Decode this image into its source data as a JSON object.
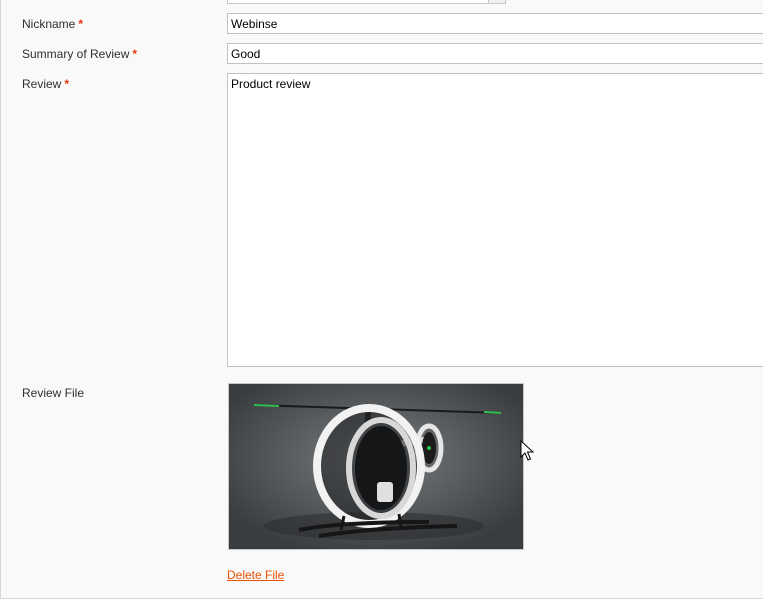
{
  "form": {
    "nickname": {
      "label": "Nickname",
      "required_mark": "*",
      "value": "Webinse"
    },
    "summary": {
      "label": "Summary of Review",
      "required_mark": "*",
      "value": "Good"
    },
    "review": {
      "label": "Review",
      "required_mark": "*",
      "value": "Product review"
    },
    "review_file": {
      "label": "Review File",
      "image_subject": "helicopter-photo",
      "delete_label": "Delete File"
    }
  },
  "colors": {
    "required": "#eb340a",
    "link": "#eb5202",
    "panel_bg": "#f9f9f9"
  }
}
